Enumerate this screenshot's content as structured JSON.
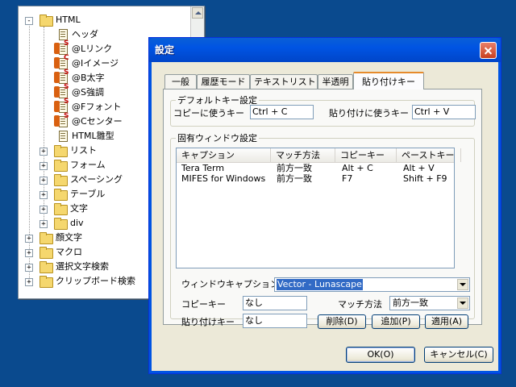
{
  "tree": {
    "items": [
      {
        "label": "HTML"
      },
      {
        "label": "ヘッダ"
      },
      {
        "label": "@Lリンク",
        "mark": "S"
      },
      {
        "label": "@Iイメージ",
        "mark": "C"
      },
      {
        "label": "@B太字",
        "mark": "S"
      },
      {
        "label": "@S強調",
        "mark": "S"
      },
      {
        "label": "@Fフォント",
        "mark": "S"
      },
      {
        "label": "@Cセンター",
        "mark": "S"
      },
      {
        "label": "HTML雛型"
      },
      {
        "label": "リスト"
      },
      {
        "label": "フォーム"
      },
      {
        "label": "スペーシング"
      },
      {
        "label": "テーブル"
      },
      {
        "label": "文字"
      },
      {
        "label": "div"
      },
      {
        "label": "顔文字"
      },
      {
        "label": "マクロ"
      },
      {
        "label": "選択文字検索"
      },
      {
        "label": "クリップボード検索"
      }
    ]
  },
  "dialog": {
    "title": "設定",
    "tabs": [
      "一般",
      "履歴モード",
      "テキストリスト",
      "半透明",
      "貼り付けキー"
    ],
    "default_keys": {
      "group_label": "デフォルトキー設定",
      "copy_label": "コピーに使うキー",
      "copy_value": "Ctrl + C",
      "paste_label": "貼り付けに使うキー",
      "paste_value": "Ctrl + V"
    },
    "window_settings": {
      "group_label": "固有ウィンドウ設定",
      "columns": [
        "キャプション",
        "マッチ方法",
        "コピーキー",
        "ペーストキー"
      ],
      "rows": [
        [
          "Tera Term",
          "前方一致",
          "Alt + C",
          "Alt + V"
        ],
        [
          "MIFES for Windows",
          "前方一致",
          "F7",
          "Shift + F9"
        ]
      ],
      "caption_label": "ウィンドウキャプション",
      "caption_value": "Vector - Lunascape",
      "copy_key_label": "コピーキー",
      "copy_key_value": "なし",
      "paste_key_label": "貼り付けキー",
      "paste_key_value": "なし",
      "match_label": "マッチ方法",
      "match_value": "前方一致",
      "delete_button": "削除(D)",
      "add_button": "追加(P)",
      "apply_button": "適用(A)"
    },
    "ok_button": "OK(O)",
    "cancel_button": "キャンセル(C)"
  }
}
